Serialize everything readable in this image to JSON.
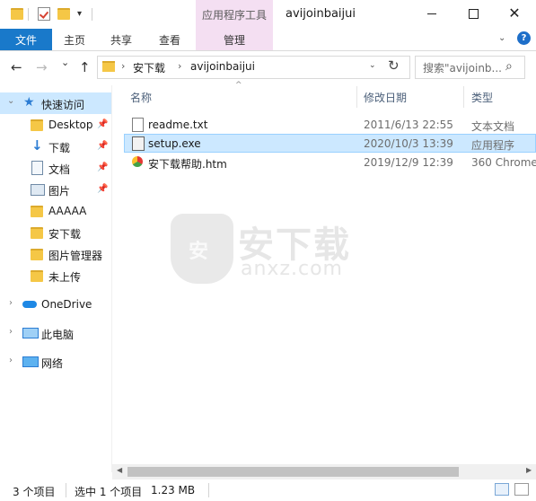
{
  "window": {
    "title": "avijoinbaijui",
    "context_tab": "应用程序工具",
    "minimize_icon": "minimize-icon",
    "maximize_icon": "maximize-icon",
    "close_glyph": "✕"
  },
  "ribbon": {
    "tabs": [
      "文件",
      "主页",
      "共享",
      "查看",
      "管理"
    ],
    "active_tab": "文件",
    "accent": "#1979ca",
    "context_color": "#f4dff2",
    "help_glyph": "?",
    "expand_glyph": "⌄"
  },
  "address": {
    "back_glyph": "←",
    "forward_glyph": "→",
    "recent_glyph": "⌄",
    "up_glyph": "↑",
    "crumbs": [
      "安下载",
      "avijoinbaijui"
    ],
    "crumb_sep": "›",
    "dropdown_glyph": "⌄",
    "refresh_glyph": "↻",
    "search_placeholder": "搜索\"avijoinb...",
    "search_glyph": "⌕"
  },
  "sidebar": {
    "quick_access": "快速访问",
    "items": [
      {
        "label": "Desktop",
        "pinned": true
      },
      {
        "label": "下载",
        "pinned": true
      },
      {
        "label": "文档",
        "pinned": true
      },
      {
        "label": "图片",
        "pinned": true
      },
      {
        "label": "AAAAA",
        "pinned": false
      },
      {
        "label": "安下载",
        "pinned": false
      },
      {
        "label": "图片管理器",
        "pinned": false
      },
      {
        "label": "未上传",
        "pinned": false
      }
    ],
    "onedrive": "OneDrive",
    "this_pc": "此电脑",
    "network": "网络",
    "chevron_expanded": "⌄",
    "chevron_collapsed": "›",
    "pin_glyph": "📌",
    "star_glyph": "★",
    "down_glyph": "↓"
  },
  "columns": {
    "name": "名称",
    "date": "修改日期",
    "type": "类型",
    "sort_glyph": "^"
  },
  "files": [
    {
      "name": "readme.txt",
      "date": "2011/6/13 22:55",
      "type": "文本文档",
      "selected": false
    },
    {
      "name": "setup.exe",
      "date": "2020/10/3 13:39",
      "type": "应用程序",
      "selected": true
    },
    {
      "name": "安下载帮助.htm",
      "date": "2019/12/9 12:39",
      "type": "360 Chrome",
      "selected": false
    }
  ],
  "watermark": {
    "logo_char": "安",
    "cn": "安下载",
    "en": "anxz.com"
  },
  "scrollbar": {
    "left_glyph": "◀",
    "right_glyph": "▶"
  },
  "status": {
    "item_count": "3 个项目",
    "selected": "选中 1 个项目",
    "size": "1.23 MB"
  }
}
